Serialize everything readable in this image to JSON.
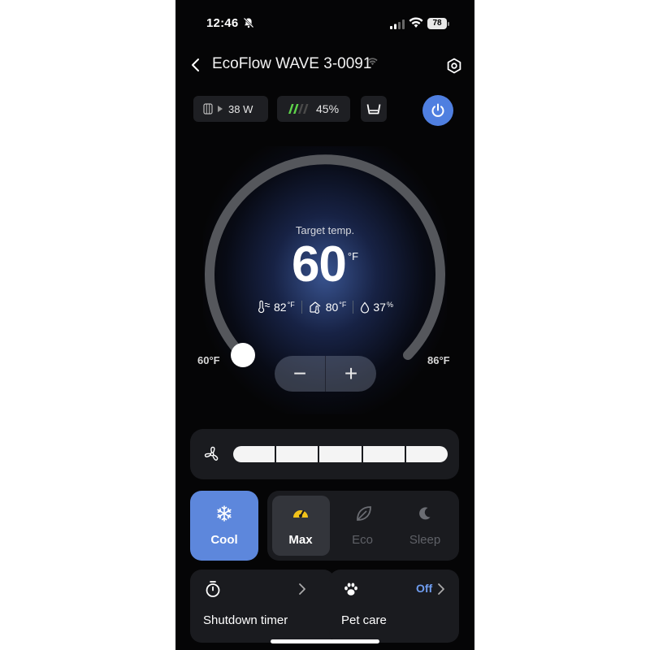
{
  "status_bar": {
    "time": "12:46",
    "battery": "78"
  },
  "header": {
    "title": "EcoFlow WAVE 3-0091"
  },
  "chips": {
    "power_value": "38 W",
    "battery_value": "45%"
  },
  "dial": {
    "target_label": "Target temp.",
    "target_value": "60",
    "unit": "°F",
    "ambient_temp": "82",
    "outdoor_temp": "80",
    "humidity": "37",
    "humidity_unit": "%",
    "min_label": "60°F",
    "max_label": "86°F",
    "min_value": 60,
    "max_value": 86,
    "current_value": 60,
    "minus": "−",
    "plus": "+"
  },
  "fan": {
    "levels": 5,
    "level": 5
  },
  "modes": {
    "cool_label": "Cool",
    "items": [
      {
        "label": "Max",
        "icon": "gauge-icon",
        "selected": true
      },
      {
        "label": "Eco",
        "icon": "leaf-icon",
        "selected": false
      },
      {
        "label": "Sleep",
        "icon": "moon-icon",
        "selected": false
      }
    ]
  },
  "cards": {
    "timer_label": "Shutdown timer",
    "pet_label": "Pet care",
    "pet_status": "Off"
  },
  "colors": {
    "accent": "#4f7fe0",
    "cool": "#5d87dc",
    "status_off": "#6f9df0",
    "max_icon": "#f2c21a"
  }
}
